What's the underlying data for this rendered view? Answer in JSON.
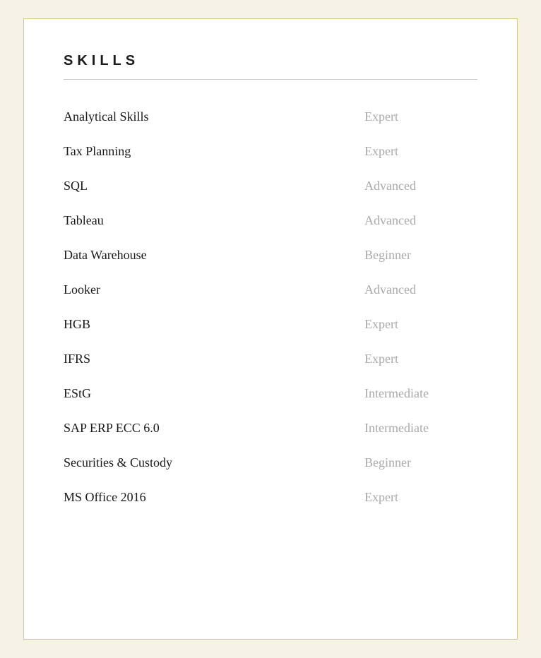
{
  "section": {
    "title": "SKILLS"
  },
  "skills": [
    {
      "name": "Analytical Skills",
      "level": "Expert"
    },
    {
      "name": "Tax Planning",
      "level": "Expert"
    },
    {
      "name": "SQL",
      "level": "Advanced"
    },
    {
      "name": "Tableau",
      "level": "Advanced"
    },
    {
      "name": "Data Warehouse",
      "level": "Beginner"
    },
    {
      "name": "Looker",
      "level": "Advanced"
    },
    {
      "name": "HGB",
      "level": "Expert"
    },
    {
      "name": "IFRS",
      "level": "Expert"
    },
    {
      "name": "EStG",
      "level": "Intermediate"
    },
    {
      "name": "SAP ERP ECC 6.0",
      "level": "Intermediate"
    },
    {
      "name": "Securities & Custody",
      "level": "Beginner"
    },
    {
      "name": "MS Office 2016",
      "level": "Expert"
    }
  ]
}
